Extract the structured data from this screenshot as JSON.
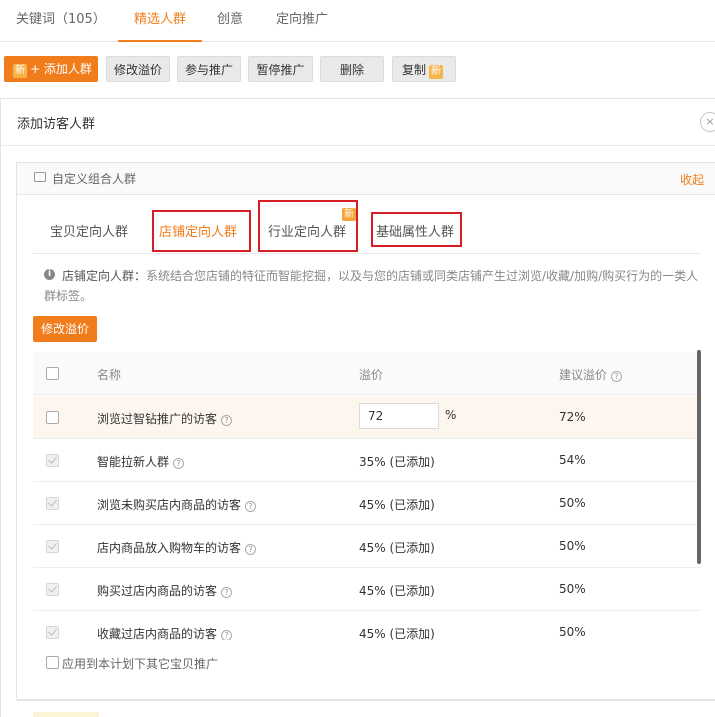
{
  "top_tabs": [
    {
      "label": "关键词（105）"
    },
    {
      "label": "精选人群"
    },
    {
      "label": "创意"
    },
    {
      "label": "定向推广"
    }
  ],
  "toolbar": {
    "new_badge": "新",
    "add_label": "+ 添加人群",
    "edit_premium": "修改溢价",
    "join_promo": "参与推广",
    "pause_promo": "暂停推广",
    "delete": "删除",
    "copy": "复制"
  },
  "panel": {
    "title": "添加访客人群",
    "close": "×",
    "custom_group": "自定义组合人群",
    "collapse": "收起"
  },
  "sub_tabs": [
    {
      "label": "宝贝定向人群"
    },
    {
      "label": "店铺定向人群"
    },
    {
      "label": "行业定向人群"
    },
    {
      "label": "基础属性人群"
    }
  ],
  "sub_tab_new_badge": "新",
  "info": {
    "icon": "i",
    "title": "店铺定向人群：",
    "text": "系统结合您店铺的特征而智能挖掘，以及与您的店铺或同类店铺产生过浏览/收藏/加购/购买行为的一类人群标签。"
  },
  "edit_button": "修改溢价",
  "table": {
    "headers": {
      "name": "名称",
      "premium": "溢价",
      "suggested": "建议溢价"
    },
    "rows": [
      {
        "name": "浏览过智钻推广的访客",
        "premium_input": "72",
        "premium_unit": "%",
        "suggested": "72%"
      },
      {
        "name": "智能拉新人群",
        "premium": "35% (已添加)",
        "suggested": "54%"
      },
      {
        "name": "浏览未购买店内商品的访客",
        "premium": "45% (已添加)",
        "suggested": "50%"
      },
      {
        "name": "店内商品放入购物车的访客",
        "premium": "45% (已添加)",
        "suggested": "50%"
      },
      {
        "name": "购买过店内商品的访客",
        "premium": "45% (已添加)",
        "suggested": "50%"
      },
      {
        "name": "收藏过店内商品的访客",
        "premium": "45% (已添加)",
        "suggested": "50%"
      }
    ]
  },
  "apply_all": "应用到本计划下其它宝贝推广",
  "help_glyph": "?"
}
